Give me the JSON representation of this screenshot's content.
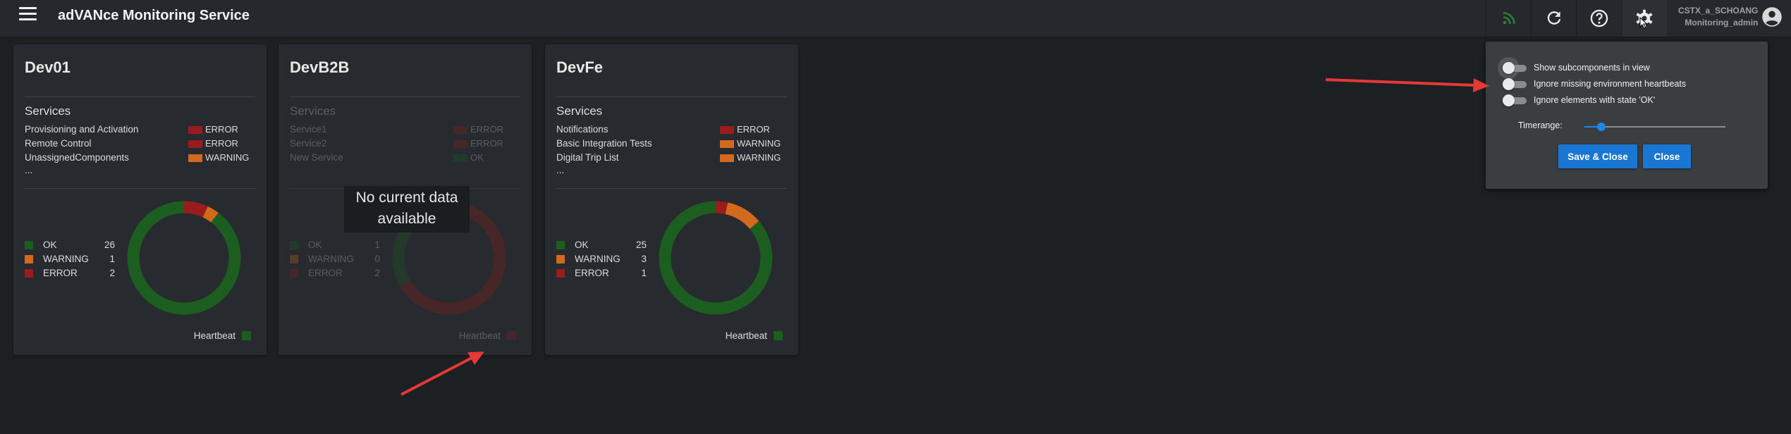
{
  "app": {
    "title": "adVANce Monitoring Service"
  },
  "user": {
    "name": "CSTX_a_SCHOANG",
    "role": "Monitoring_admin"
  },
  "toolbar": {
    "icons": [
      "rss-feed-icon",
      "refresh-icon",
      "help-icon",
      "gear-icon",
      "account-icon"
    ],
    "rss_color": "#2e7d32"
  },
  "colors": {
    "ok": "#1b5e20",
    "warning": "#d2691e",
    "error": "#9b1c1c",
    "accent": "#1976d2",
    "annotation": "#e53935"
  },
  "cards": [
    {
      "title": "Dev01",
      "section": "Services",
      "services": [
        {
          "name": "Provisioning and Activation",
          "state": "ERROR"
        },
        {
          "name": "Remote Control",
          "state": "ERROR"
        },
        {
          "name": "UnassignedComponents",
          "state": "WARNING"
        }
      ],
      "more": "...",
      "legend": [
        {
          "label": "OK",
          "count": "26"
        },
        {
          "label": "WARNING",
          "count": "1"
        },
        {
          "label": "ERROR",
          "count": "2"
        }
      ],
      "heartbeat_label": "Heartbeat",
      "heartbeat_state": "OK"
    },
    {
      "title": "DevB2B",
      "section": "Services",
      "services": [
        {
          "name": "Service1",
          "state": "ERROR"
        },
        {
          "name": "Service2",
          "state": "ERROR"
        },
        {
          "name": "New Service",
          "state": "OK"
        }
      ],
      "legend": [
        {
          "label": "OK",
          "count": "1"
        },
        {
          "label": "WARNING",
          "count": "0"
        },
        {
          "label": "ERROR",
          "count": "2"
        }
      ],
      "overlay": "No current data available",
      "heartbeat_label": "Heartbeat",
      "heartbeat_state": "ERROR"
    },
    {
      "title": "DevFe",
      "section": "Services",
      "services": [
        {
          "name": "Notifications",
          "state": "ERROR"
        },
        {
          "name": "Basic Integration Tests",
          "state": "WARNING"
        },
        {
          "name": "Digital Trip List",
          "state": "WARNING"
        }
      ],
      "more": "...",
      "legend": [
        {
          "label": "OK",
          "count": "25"
        },
        {
          "label": "WARNING",
          "count": "3"
        },
        {
          "label": "ERROR",
          "count": "1"
        }
      ],
      "heartbeat_label": "Heartbeat",
      "heartbeat_state": "OK"
    }
  ],
  "settings": {
    "options": [
      {
        "label": "Show subcomponents in view",
        "checked": false
      },
      {
        "label": "Ignore missing environment heartbeats",
        "checked": false
      },
      {
        "label": "Ignore elements with state 'OK'",
        "checked": false
      }
    ],
    "timerange_label": "Timerange:",
    "timerange_fraction": 0.12,
    "save_label": "Save & Close",
    "close_label": "Close"
  }
}
